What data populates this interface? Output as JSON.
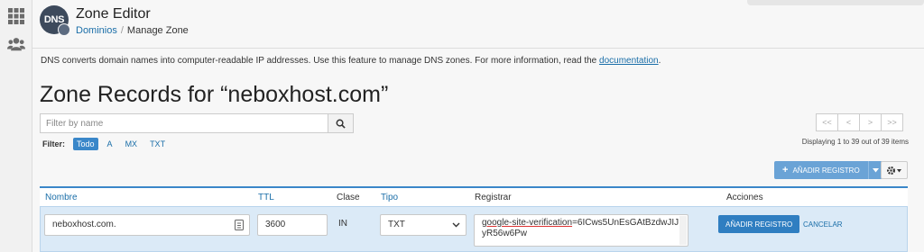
{
  "app": {
    "logo_text": "DNS",
    "title": "Zone Editor",
    "breadcrumb": {
      "parent": "Dominios",
      "separator": "/",
      "current": "Manage Zone"
    }
  },
  "description": {
    "text": "DNS converts domain names into computer-readable IP addresses. Use this feature to manage DNS zones. For more information, read the ",
    "link": "documentation",
    "after": "."
  },
  "page_title": "Zone Records for “neboxhost.com”",
  "search": {
    "placeholder": "Filter by name",
    "value": ""
  },
  "filter": {
    "label": "Filter:",
    "options": [
      "Todo",
      "A",
      "MX",
      "TXT"
    ],
    "selected": "Todo"
  },
  "pagination": {
    "buttons": [
      "<<",
      "<",
      ">",
      ">>"
    ],
    "status": "Displaying 1 to 39 out of 39 items"
  },
  "actions": {
    "add_label": "AÑADIR REGISTRO"
  },
  "table": {
    "columns": [
      "Nombre",
      "TTL",
      "Clase",
      "Tipo",
      "Registrar",
      "Acciones"
    ]
  },
  "edit_row": {
    "name": "neboxhost.com.",
    "ttl": "3600",
    "class": "IN",
    "type": "TXT",
    "record_underlined": "google-site-verification",
    "record_rest": "=6ICws5UnEsGAtBzdwJIJyR56w6Pw",
    "save_label": "AÑADIR REGISTRO",
    "cancel_label": "CANCELAR"
  },
  "colors": {
    "accent": "#3a87c9",
    "link": "#1a6ea8",
    "row_highlight": "#dbeaf7",
    "primary_button": "#2f7ec1"
  },
  "icons": [
    "apps-grid-icon",
    "users-icon",
    "dns-logo",
    "search-icon",
    "plus-icon",
    "caret-down-icon",
    "gear-icon",
    "chevron-down-icon",
    "field-menu-icon"
  ]
}
